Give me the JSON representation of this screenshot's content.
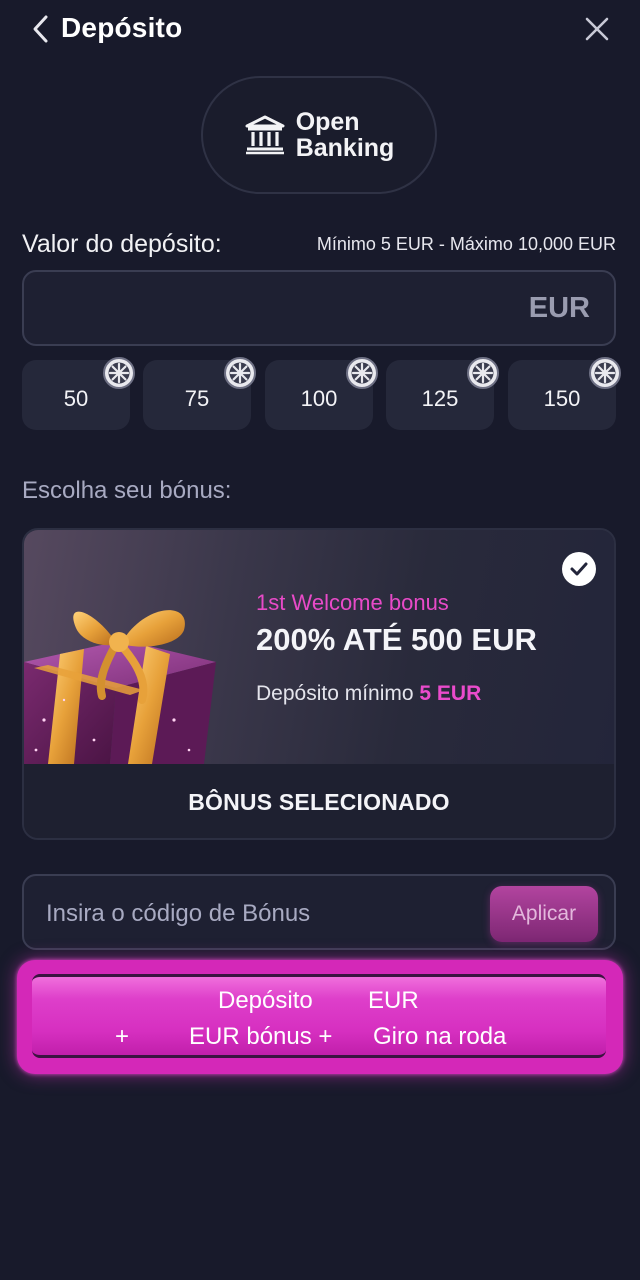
{
  "header": {
    "title": "Depósito",
    "back_icon": "chevron-left-icon",
    "close_icon": "close-icon"
  },
  "payment_method": {
    "label": "Open\nBanking",
    "icon": "bank-icon"
  },
  "deposit": {
    "label": "Valor do depósito:",
    "range": "Mínimo 5 EUR - Máximo 10,000 EUR",
    "value": "",
    "currency": "EUR",
    "quick_amounts": [
      "50",
      "75",
      "100",
      "125",
      "150"
    ],
    "quick_amount_badge_icon": "wheel-icon"
  },
  "bonus": {
    "heading": "Escolha seu bónus:",
    "eyebrow": "1st Welcome bonus",
    "title": "200% ATÉ 500 EUR",
    "min_prefix": "Depósito mínimo",
    "min_value": "5 EUR",
    "status": "BÔNUS SELECIONADO",
    "selected_icon": "check-icon",
    "image_icon": "gift-icon"
  },
  "bonus_code": {
    "placeholder": "Insira o código de Bónus",
    "value": "",
    "apply_label": "Aplicar"
  },
  "cta": {
    "deposit_word": "Depósito",
    "deposit_currency": "EUR",
    "plus1": "+",
    "bonus_part": "EUR bónus +",
    "wheel_part": "Giro na roda"
  },
  "colors": {
    "background": "#181a2b",
    "accent": "#e84ac8",
    "cta": "#d428b8"
  }
}
